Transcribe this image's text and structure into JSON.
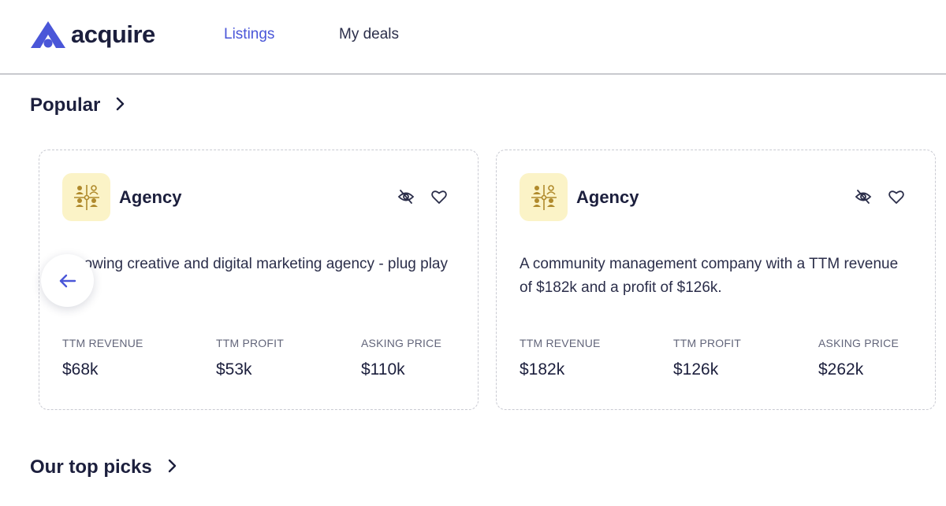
{
  "header": {
    "logo_text": "acquire",
    "nav": {
      "listings": "Listings",
      "my_deals": "My deals"
    },
    "active_color": "#4a56d8"
  },
  "sections": {
    "popular": {
      "title": "Popular",
      "icon": "chevron-right-icon"
    },
    "top_picks": {
      "title": "Our top picks",
      "icon": "chevron-right-icon"
    }
  },
  "carousel": {
    "prev_icon": "arrow-left-icon",
    "cards": [
      {
        "category": "Agency",
        "category_icon": "people-network-icon",
        "description": "t growing creative and digital marketing agency - plug play",
        "metrics": [
          {
            "label": "TTM REVENUE",
            "value": "$68k"
          },
          {
            "label": "TTM PROFIT",
            "value": "$53k"
          },
          {
            "label": "ASKING PRICE",
            "value": "$110k"
          }
        ]
      },
      {
        "category": "Agency",
        "category_icon": "people-network-icon",
        "description": "A community management company with a TTM revenue of $182k and a profit of $126k.",
        "metrics": [
          {
            "label": "TTM REVENUE",
            "value": "$182k"
          },
          {
            "label": "TTM PROFIT",
            "value": "$126k"
          },
          {
            "label": "ASKING PRICE",
            "value": "$262k"
          }
        ]
      }
    ]
  }
}
